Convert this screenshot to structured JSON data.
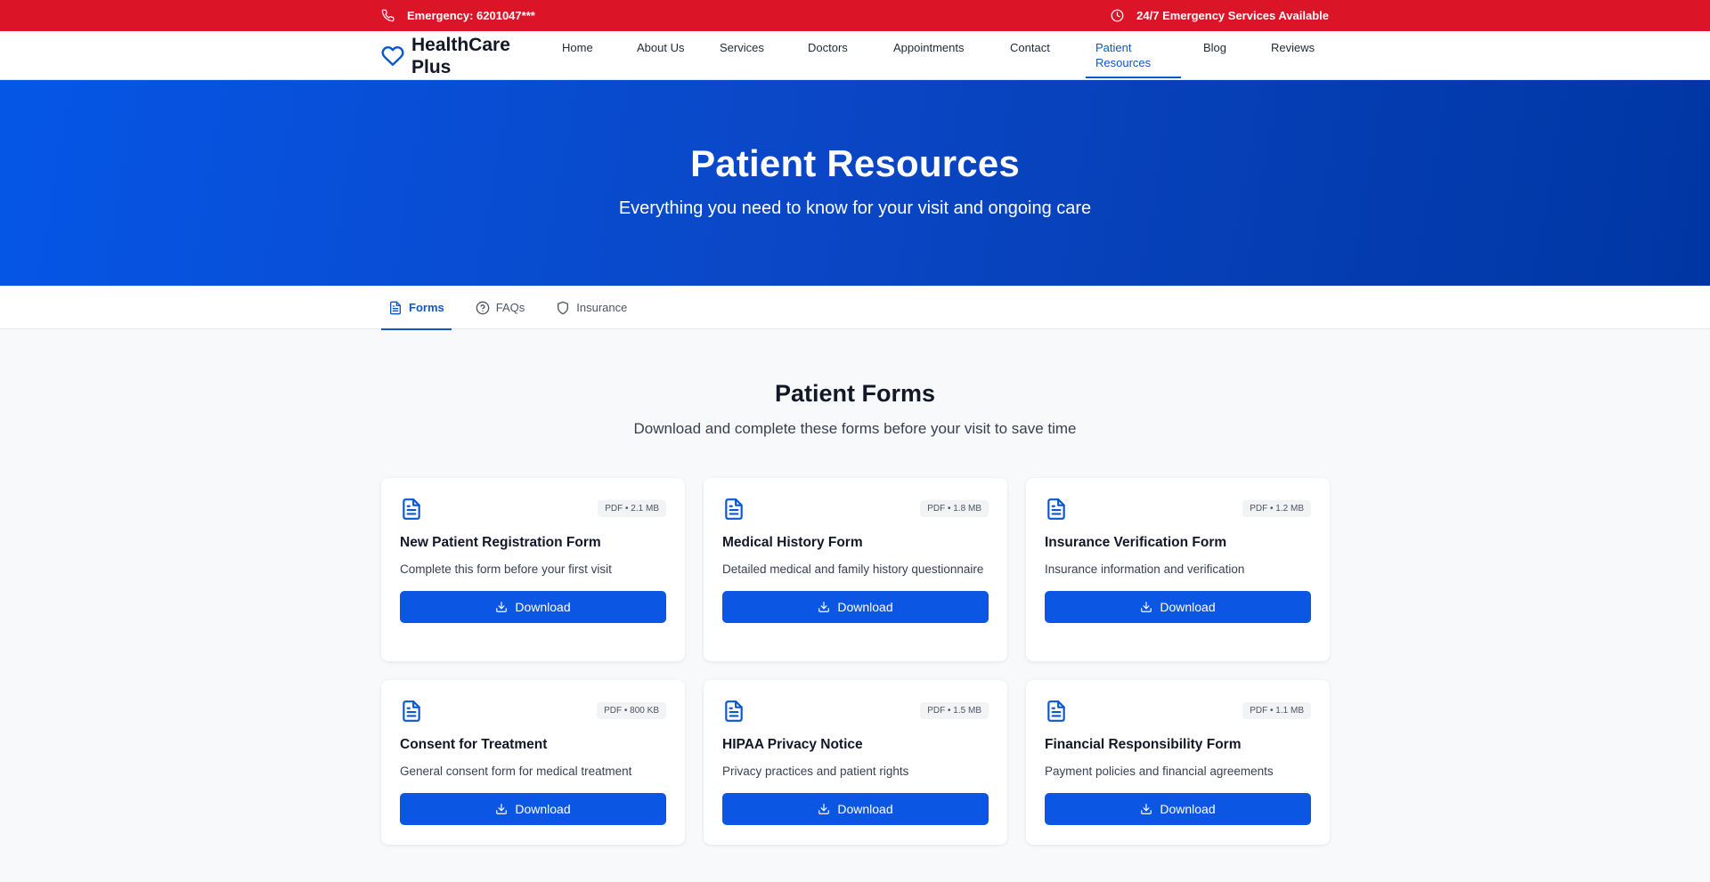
{
  "topbar": {
    "emergency": "Emergency: 6201047***",
    "services": "24/7 Emergency Services Available"
  },
  "brand": {
    "name": "HealthCare Plus"
  },
  "nav": {
    "items": [
      "Home",
      "About Us",
      "Services",
      "Doctors",
      "Appointments",
      "Contact",
      "Patient Resources",
      "Blog",
      "Reviews"
    ],
    "active": "Patient Resources"
  },
  "hero": {
    "title": "Patient Resources",
    "subtitle": "Everything you need to know for your visit and ongoing care"
  },
  "tabs": {
    "items": [
      "Forms",
      "FAQs",
      "Insurance"
    ],
    "active": "Forms"
  },
  "section": {
    "title": "Patient Forms",
    "subtitle": "Download and complete these forms before your visit to save time"
  },
  "forms": [
    {
      "title": "New Patient Registration Form",
      "description": "Complete this form before your first visit",
      "meta": "PDF • 2.1 MB",
      "button": "Download"
    },
    {
      "title": "Medical History Form",
      "description": "Detailed medical and family history questionnaire",
      "meta": "PDF • 1.8 MB",
      "button": "Download"
    },
    {
      "title": "Insurance Verification Form",
      "description": "Insurance information and verification",
      "meta": "PDF • 1.2 MB",
      "button": "Download"
    },
    {
      "title": "Consent for Treatment",
      "description": "General consent form for medical treatment",
      "meta": "PDF • 800 KB",
      "button": "Download"
    },
    {
      "title": "HIPAA Privacy Notice",
      "description": "Privacy practices and patient rights",
      "meta": "PDF • 1.5 MB",
      "button": "Download"
    },
    {
      "title": "Financial Responsibility Form",
      "description": "Payment policies and financial agreements",
      "meta": "PDF • 1.1 MB",
      "button": "Download"
    }
  ],
  "colors": {
    "topbar": "#dc1427",
    "primary": "#0b57e3",
    "hero_start": "#0656e6",
    "hero_end": "#0036a3"
  },
  "icons": {
    "phone": "phone-icon",
    "clock": "clock-icon",
    "logo": "heart-icon",
    "forms_tab": "document-icon",
    "faqs_tab": "help-circle-icon",
    "insurance_tab": "shield-icon",
    "card": "document-icon",
    "download": "download-icon"
  }
}
